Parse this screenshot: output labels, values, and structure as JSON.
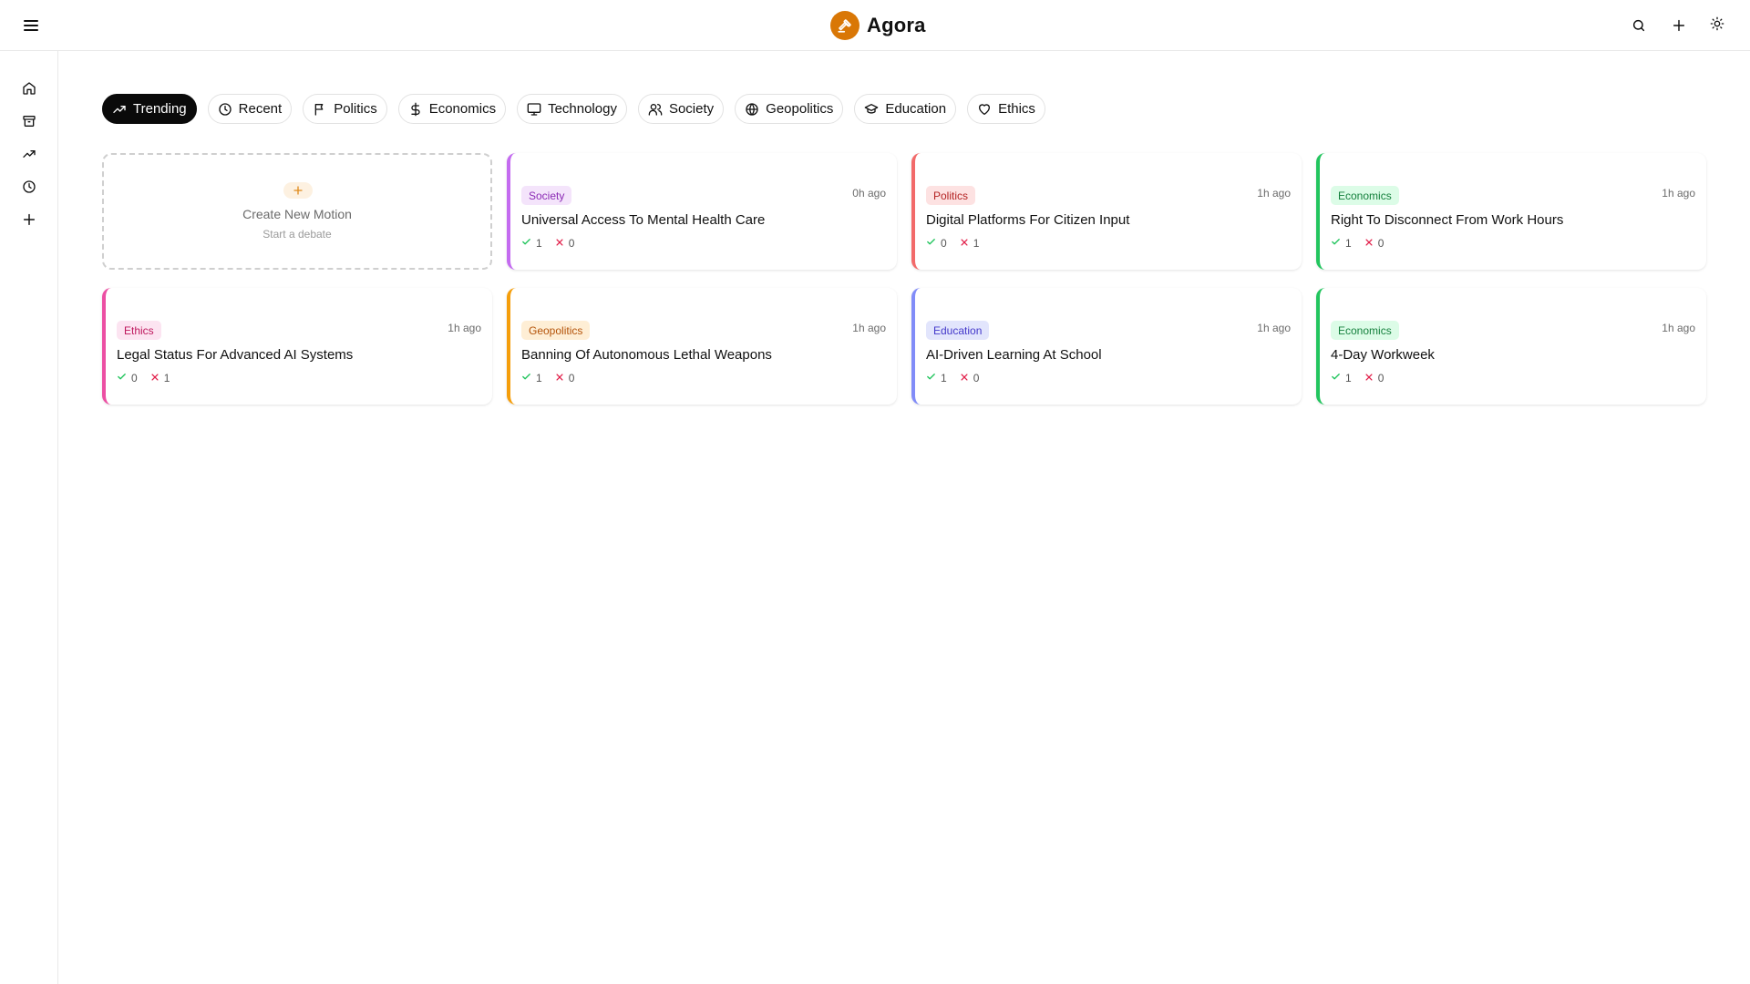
{
  "app": {
    "name": "Agora",
    "brand_color": "#d97706"
  },
  "header": {
    "icons": [
      "menu-icon",
      "search-icon",
      "plus-icon",
      "sun-icon"
    ]
  },
  "sidebar": {
    "items": [
      {
        "icon": "home-icon"
      },
      {
        "icon": "archive-icon"
      },
      {
        "icon": "trending-icon"
      },
      {
        "icon": "clock-icon"
      },
      {
        "icon": "plus-icon"
      }
    ]
  },
  "filters": [
    {
      "label": "Trending",
      "icon": "trending-icon",
      "active": true
    },
    {
      "label": "Recent",
      "icon": "clock-icon",
      "active": false
    },
    {
      "label": "Politics",
      "icon": "flag-icon",
      "active": false
    },
    {
      "label": "Economics",
      "icon": "dollar-icon",
      "active": false
    },
    {
      "label": "Technology",
      "icon": "monitor-icon",
      "active": false
    },
    {
      "label": "Society",
      "icon": "users-icon",
      "active": false
    },
    {
      "label": "Geopolitics",
      "icon": "globe-icon",
      "active": false
    },
    {
      "label": "Education",
      "icon": "graduation-cap-icon",
      "active": false
    },
    {
      "label": "Ethics",
      "icon": "heart-icon",
      "active": false
    }
  ],
  "create_card": {
    "title": "Create New Motion",
    "subtitle": "Start a debate"
  },
  "motions": [
    {
      "tag": "Society",
      "time": "0h ago",
      "title": "Universal Access To Mental Health Care",
      "yes": "1",
      "no": "0",
      "accent": "#c46bf0",
      "tag_bg": "#f4e4fb",
      "tag_fg": "#8b2bb5"
    },
    {
      "tag": "Politics",
      "time": "1h ago",
      "title": "Digital Platforms For Citizen Input",
      "yes": "0",
      "no": "1",
      "accent": "#f26a6a",
      "tag_bg": "#fde2e2",
      "tag_fg": "#b42323"
    },
    {
      "tag": "Economics",
      "time": "1h ago",
      "title": "Right To Disconnect From Work Hours",
      "yes": "1",
      "no": "0",
      "accent": "#22c55e",
      "tag_bg": "#dcfce7",
      "tag_fg": "#15803d"
    },
    {
      "tag": "Ethics",
      "time": "1h ago",
      "title": "Legal Status For Advanced AI Systems",
      "yes": "0",
      "no": "1",
      "accent": "#ec4fa3",
      "tag_bg": "#fce4f1",
      "tag_fg": "#be185d"
    },
    {
      "tag": "Geopolitics",
      "time": "1h ago",
      "title": "Banning Of Autonomous Lethal Weapons",
      "yes": "1",
      "no": "0",
      "accent": "#f59e0b",
      "tag_bg": "#feeed5",
      "tag_fg": "#b45309"
    },
    {
      "tag": "Education",
      "time": "1h ago",
      "title": "AI-Driven Learning At School",
      "yes": "1",
      "no": "0",
      "accent": "#818cf8",
      "tag_bg": "#e2e5fc",
      "tag_fg": "#4338ca"
    },
    {
      "tag": "Economics",
      "time": "1h ago",
      "title": "4-Day Workweek",
      "yes": "1",
      "no": "0",
      "accent": "#22c55e",
      "tag_bg": "#dcfce7",
      "tag_fg": "#15803d"
    }
  ]
}
